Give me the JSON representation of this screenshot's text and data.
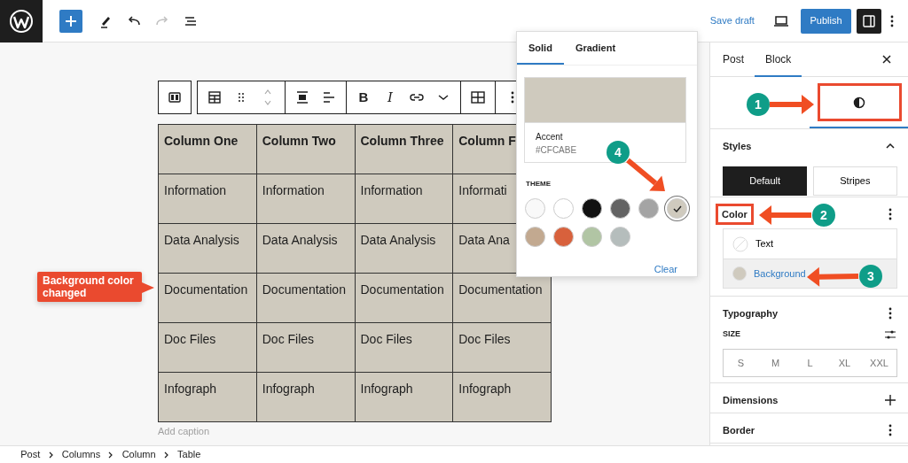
{
  "topbar": {
    "undo_enabled": true,
    "redo_enabled": false,
    "save_draft": "Save draft",
    "publish": "Publish",
    "sidebar_open": true
  },
  "block_toolbar": {
    "bold": "B",
    "italic": "I"
  },
  "table": {
    "columns": [
      "Column One",
      "Column Two",
      "Column Three",
      "Column F"
    ],
    "rows": [
      [
        "Information",
        "Information",
        "Information",
        "Informati"
      ],
      [
        "Data Analysis",
        "Data Analysis",
        "Data Analysis",
        "Data Ana"
      ],
      [
        "Documentation",
        "Documentation",
        "Documentation",
        "Documentation"
      ],
      [
        "Doc Files",
        "Doc Files",
        "Doc Files",
        "Doc Files"
      ],
      [
        "Infograph",
        "Infograph",
        "Infograph",
        "Infograph"
      ]
    ],
    "caption_placeholder": "Add caption"
  },
  "callout": {
    "text": "Background color changed"
  },
  "color_popover": {
    "tabs": [
      {
        "label": "Solid",
        "selected": true
      },
      {
        "label": "Gradient",
        "selected": false
      }
    ],
    "preview": {
      "color": "#cfcabe",
      "name": "Accent",
      "hex": "#CFCABE"
    },
    "section": "THEME",
    "swatches": [
      {
        "color": "#f9f9f9",
        "selected": false
      },
      {
        "color": "#ffffff",
        "selected": false
      },
      {
        "color": "#111111",
        "selected": false
      },
      {
        "color": "#636363",
        "selected": false
      },
      {
        "color": "#a4a4a4",
        "selected": false
      },
      {
        "color": "#cfcabe",
        "selected": true
      },
      {
        "color": "#c2a990",
        "selected": false
      },
      {
        "color": "#d8613c",
        "selected": false
      },
      {
        "color": "#b1c5a4",
        "selected": false
      },
      {
        "color": "#b5bdbc",
        "selected": false
      }
    ],
    "clear": "Clear"
  },
  "sidebar": {
    "tabs": [
      {
        "label": "Post",
        "selected": false
      },
      {
        "label": "Block",
        "selected": true
      }
    ],
    "styles": {
      "title": "Styles",
      "expanded": true,
      "options": [
        {
          "label": "Default",
          "selected": true
        },
        {
          "label": "Stripes",
          "selected": false
        }
      ]
    },
    "color": {
      "title": "Color",
      "items": [
        {
          "label": "Text",
          "kind": "empty",
          "selected": false
        },
        {
          "label": "Background",
          "kind": "swatch",
          "color": "#cfcabe",
          "selected": true
        }
      ]
    },
    "typography": {
      "title": "Typography",
      "size_label": "SIZE",
      "sizes": [
        {
          "label": "S",
          "selected": false
        },
        {
          "label": "M",
          "selected": false
        },
        {
          "label": "L",
          "selected": false
        },
        {
          "label": "XL",
          "selected": false
        },
        {
          "label": "XXL",
          "selected": false
        }
      ]
    },
    "panels": [
      {
        "title": "Dimensions",
        "kind": "add"
      },
      {
        "title": "Border",
        "kind": "menu"
      }
    ]
  },
  "annotations": [
    {
      "number": "1"
    },
    {
      "number": "2"
    },
    {
      "number": "3"
    },
    {
      "number": "4"
    }
  ],
  "breadcrumb": [
    "Post",
    "Columns",
    "Column",
    "Table"
  ]
}
